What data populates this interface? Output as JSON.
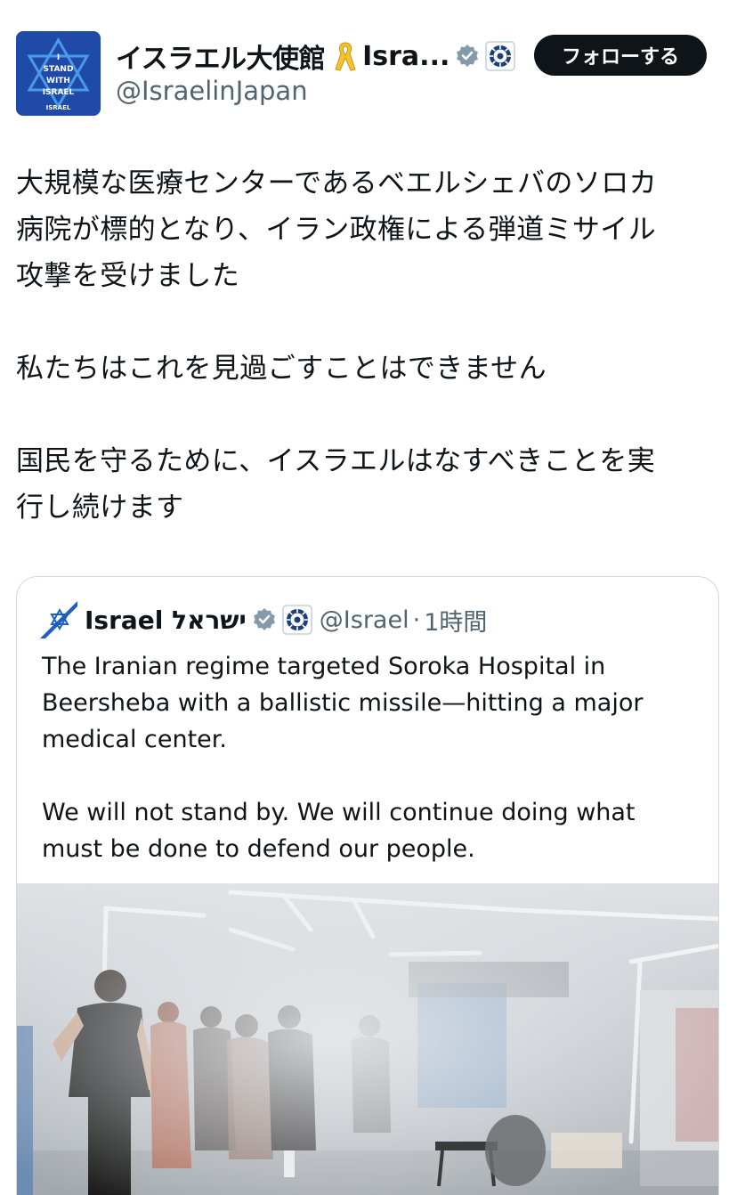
{
  "author": {
    "avatar_text": "I\nSTAND\nWITH\nISRAEL",
    "avatar_brand": "ISRAEL",
    "display_name": "イスラエル大使館",
    "display_name_suffix": "Isra...",
    "handle": "@IsraelinJapan",
    "ribbon_icon": "yellow-ribbon-icon",
    "verified_icon": "verified-badge-icon",
    "affiliate_icon": "government-seal-icon"
  },
  "follow_button": {
    "label": "フォローする"
  },
  "tweet": {
    "paragraph_1_line_1": "大規模な医療センターであるベエルシェバのソロカ",
    "paragraph_1_line_2": "病院が標的となり、イラン政権による弾道ミサイル",
    "paragraph_1_line_3": "攻撃を受けました",
    "paragraph_2": "私たちはこれを見過ごすことはできません",
    "paragraph_3_line_1": "国民を守るために、イスラエルはなすべきことを実",
    "paragraph_3_line_2": "行し続けます"
  },
  "quoted": {
    "display_name": "Israel ישראל",
    "handle": "@Israel",
    "separator": "·",
    "time": "1時間",
    "text_line_1": "The Iranian regime targeted Soroka Hospital in",
    "text_line_2": "Beersheba with a ballistic missile—hitting a major",
    "text_line_3": "medical center.",
    "text_line_4": "We will not stand by. We will continue doing what",
    "text_line_5": "must be done to defend our people.",
    "media": "video-thumbnail"
  },
  "colors": {
    "text_primary": "#0f1419",
    "text_secondary": "#536471",
    "border": "#cfd9de",
    "follow_bg": "#0f1419",
    "avatar_bg": "#1f4aa8",
    "ribbon": "#f2c230",
    "verified_badge": "#829aab"
  }
}
